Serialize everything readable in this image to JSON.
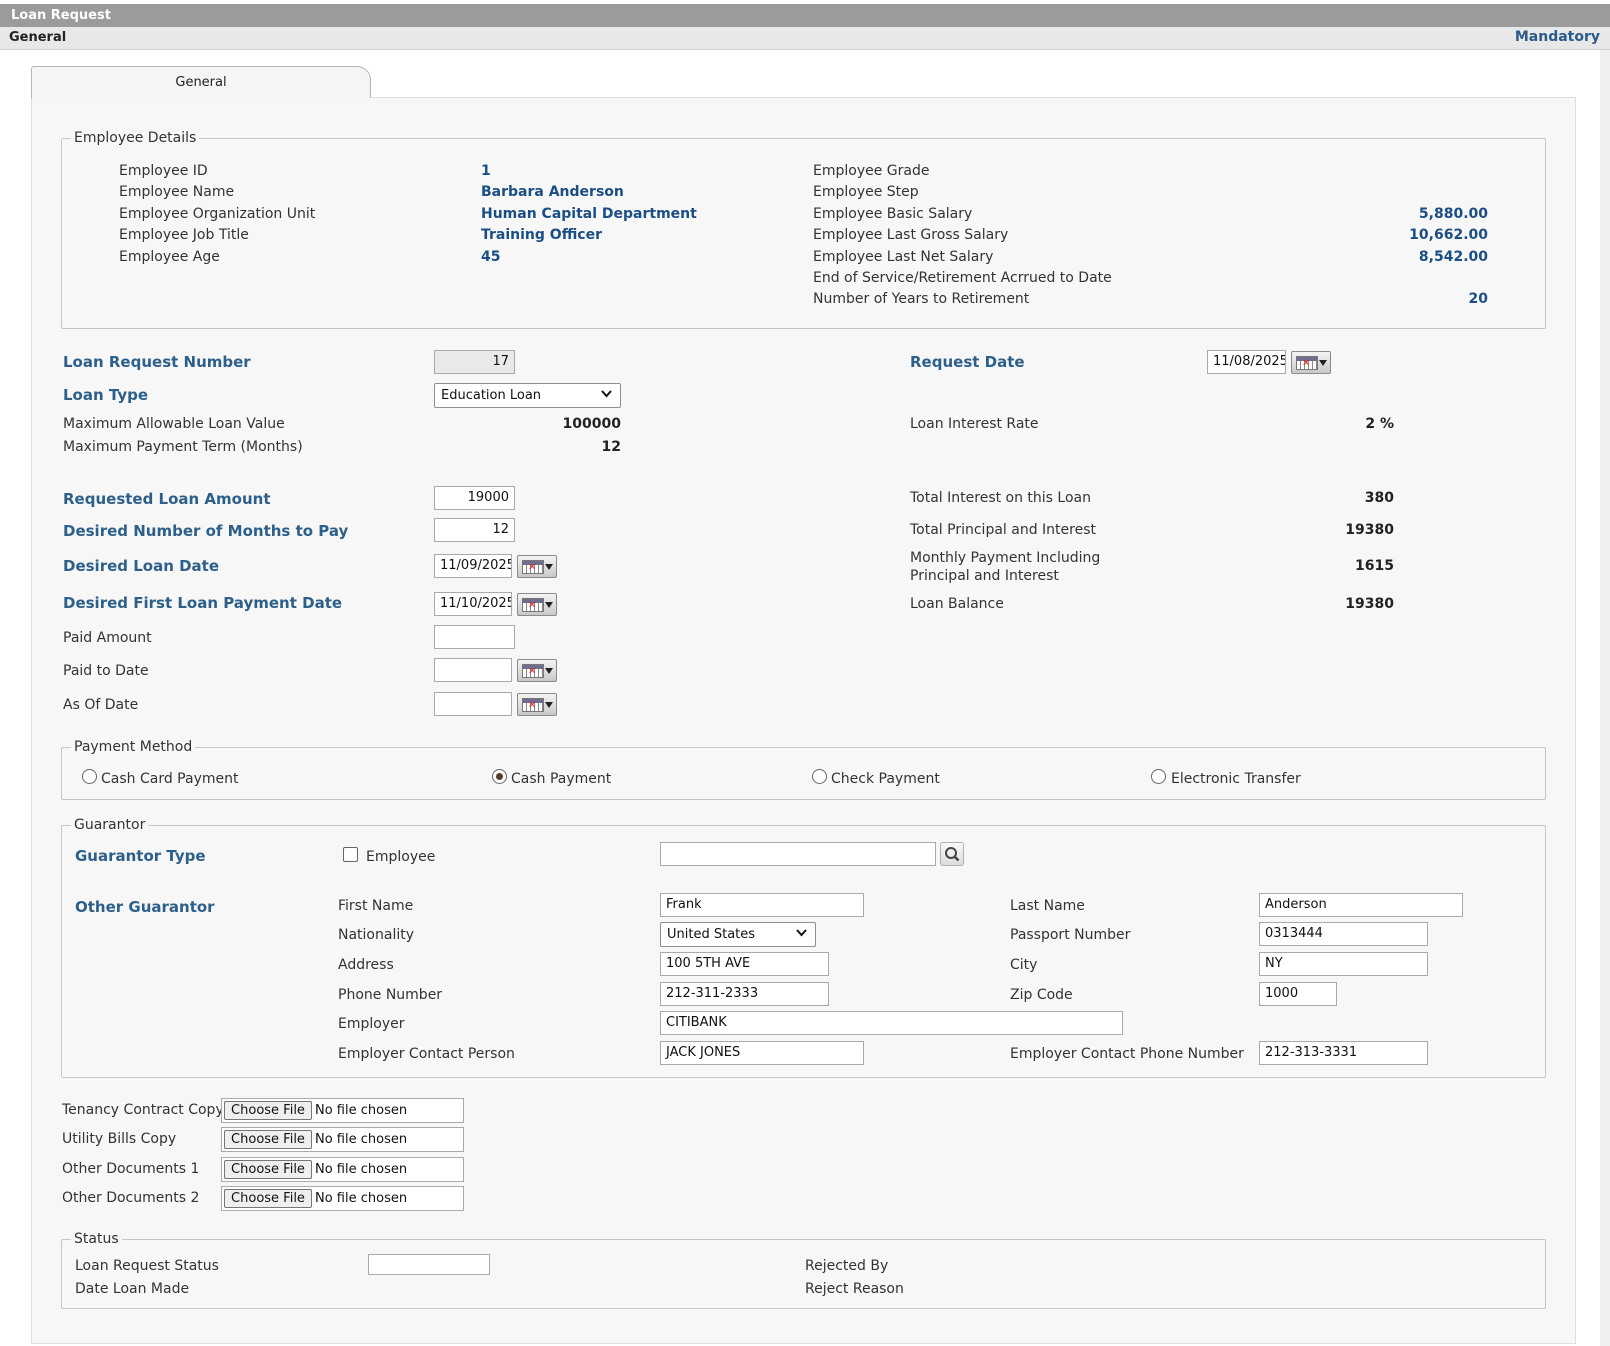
{
  "window": {
    "title": "Loan Request"
  },
  "section_bar": {
    "left": "General",
    "right": "Mandatory"
  },
  "tabs": [
    {
      "label": "General",
      "active": true
    }
  ],
  "employee_details": {
    "legend": "Employee Details",
    "left": [
      {
        "label": "Employee ID",
        "value": "1"
      },
      {
        "label": "Employee Name",
        "value": "Barbara Anderson"
      },
      {
        "label": "Employee Organization Unit",
        "value": "Human Capital Department"
      },
      {
        "label": "Employee Job Title",
        "value": "Training Officer"
      },
      {
        "label": "Employee Age",
        "value": "45"
      }
    ],
    "right": [
      {
        "label": "Employee Grade",
        "value": ""
      },
      {
        "label": "Employee Step",
        "value": ""
      },
      {
        "label": "Employee Basic Salary",
        "value": "5,880.00"
      },
      {
        "label": "Employee Last Gross Salary",
        "value": "10,662.00"
      },
      {
        "label": "Employee Last Net Salary",
        "value": "8,542.00"
      },
      {
        "label": "End of Service/Retirement Acrrued to Date",
        "value": ""
      },
      {
        "label": "Number of Years to Retirement",
        "value": "20"
      }
    ]
  },
  "loan": {
    "request_number": {
      "label": "Loan Request Number",
      "value": "17"
    },
    "request_date": {
      "label": "Request Date",
      "value": "11/08/2025"
    },
    "loan_type": {
      "label": "Loan Type",
      "value": "Education Loan"
    },
    "max_allowable": {
      "label": "Maximum Allowable Loan Value",
      "value": "100000"
    },
    "max_term": {
      "label": "Maximum Payment Term (Months)",
      "value": "12"
    },
    "interest_rate": {
      "label": "Loan Interest Rate",
      "value": "2 %"
    },
    "requested_amount": {
      "label": "Requested Loan Amount",
      "value": "19000"
    },
    "months_to_pay": {
      "label": "Desired Number of Months to Pay",
      "value": "12"
    },
    "loan_date": {
      "label": "Desired Loan Date",
      "value": "11/09/2025"
    },
    "first_payment_date": {
      "label": "Desired First Loan Payment Date",
      "value": "11/10/2025"
    },
    "paid_amount": {
      "label": "Paid Amount",
      "value": ""
    },
    "paid_to_date": {
      "label": "Paid to Date",
      "value": ""
    },
    "as_of_date": {
      "label": "As Of Date",
      "value": ""
    },
    "total_interest": {
      "label": "Total Interest on this Loan",
      "value": "380"
    },
    "total_principal_interest": {
      "label": "Total Principal and Interest",
      "value": "19380"
    },
    "monthly_payment": {
      "label_line1": "Monthly Payment Including",
      "label_line2": "Principal and Interest",
      "value": "1615"
    },
    "loan_balance": {
      "label": "Loan Balance",
      "value": "19380"
    }
  },
  "payment_method": {
    "legend": "Payment Method",
    "options": [
      {
        "label": "Cash Card Payment",
        "selected": false
      },
      {
        "label": "Cash Payment",
        "selected": true
      },
      {
        "label": "Check Payment",
        "selected": false
      },
      {
        "label": "Electronic Transfer",
        "selected": false
      }
    ]
  },
  "guarantor": {
    "legend": "Guarantor",
    "type_label": "Guarantor Type",
    "employee_checkbox_label": "Employee",
    "employee_search_value": "",
    "other_label": "Other Guarantor",
    "first_name": {
      "label": "First Name",
      "value": "Frank"
    },
    "last_name": {
      "label": "Last Name",
      "value": "Anderson"
    },
    "nationality": {
      "label": "Nationality",
      "value": "United States"
    },
    "passport": {
      "label": "Passport Number",
      "value": "0313444"
    },
    "address": {
      "label": "Address",
      "value": "100 5TH AVE"
    },
    "city": {
      "label": "City",
      "value": "NY"
    },
    "phone": {
      "label": "Phone Number",
      "value": "212-311-2333"
    },
    "zip": {
      "label": "Zip Code",
      "value": "1000"
    },
    "employer": {
      "label": "Employer",
      "value": "CITIBANK"
    },
    "employer_contact": {
      "label": "Employer Contact Person",
      "value": "JACK JONES"
    },
    "employer_contact_phone": {
      "label": "Employer Contact Phone Number",
      "value": "212-313-3331"
    }
  },
  "attachments": {
    "button_label": "Choose File",
    "empty_text": "No file chosen",
    "items": [
      {
        "label": "Tenancy Contract Copy"
      },
      {
        "label": "Utility Bills Copy"
      },
      {
        "label": "Other Documents 1"
      },
      {
        "label": "Other Documents 2"
      }
    ]
  },
  "status": {
    "legend": "Status",
    "loan_request_status": {
      "label": "Loan Request Status",
      "value": ""
    },
    "date_loan_made": {
      "label": "Date Loan Made",
      "value": ""
    },
    "rejected_by": {
      "label": "Rejected By",
      "value": ""
    },
    "reject_reason": {
      "label": "Reject Reason",
      "value": ""
    }
  },
  "colors": {
    "accent": "#2c5f8a",
    "value_blue": "#1a4e85",
    "title_bar": "#9b9b9b"
  },
  "icons": {
    "calendar": "calendar-icon",
    "search": "search-icon",
    "dropdown": "chevron-down-icon"
  }
}
